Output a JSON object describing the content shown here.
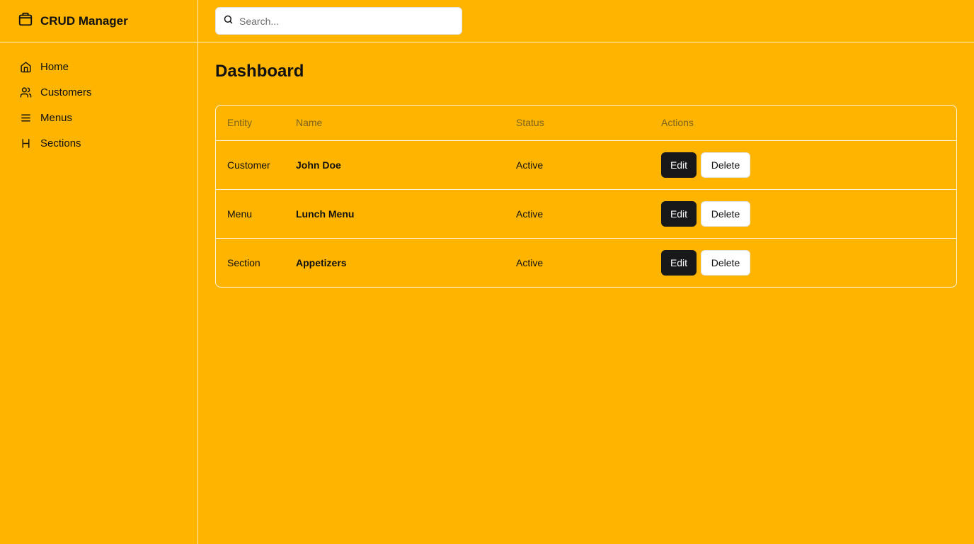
{
  "app": {
    "title": "CRUD Manager",
    "logo_icon": "package-icon"
  },
  "sidebar": {
    "items": [
      {
        "label": "Home",
        "icon": "home-icon"
      },
      {
        "label": "Customers",
        "icon": "users-icon"
      },
      {
        "label": "Menus",
        "icon": "menu-icon"
      },
      {
        "label": "Sections",
        "icon": "heading-icon"
      }
    ]
  },
  "search": {
    "placeholder": "Search...",
    "value": ""
  },
  "main": {
    "title": "Dashboard",
    "table": {
      "headers": {
        "entity": "Entity",
        "name": "Name",
        "status": "Status",
        "actions": "Actions"
      },
      "rows": [
        {
          "entity": "Customer",
          "name": "John Doe",
          "status": "Active"
        },
        {
          "entity": "Menu",
          "name": "Lunch Menu",
          "status": "Active"
        },
        {
          "entity": "Section",
          "name": "Appetizers",
          "status": "Active"
        }
      ],
      "edit_label": "Edit",
      "delete_label": "Delete"
    }
  },
  "colors": {
    "background": "#ffb400",
    "primary_button": "#18181b",
    "secondary_button": "#ffffff"
  }
}
